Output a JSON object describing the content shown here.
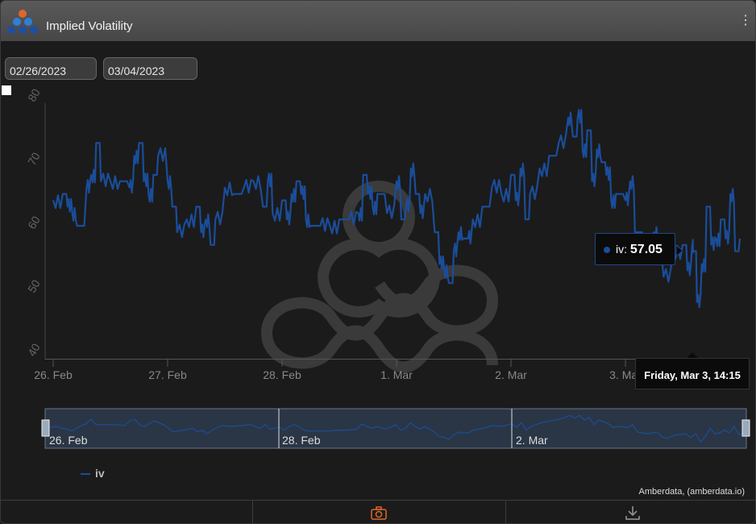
{
  "window": {
    "title": "Implied Volatility",
    "menu_glyph": "⋮"
  },
  "date_range": {
    "from": "02/26/2023",
    "to": "03/04/2023"
  },
  "chart_data": {
    "type": "line",
    "ylim": [
      40,
      80
    ],
    "yticks": [
      40,
      50,
      60,
      70,
      80
    ],
    "x_start": "2023-02-26T00:00",
    "x_end": "2023-03-04T00:00",
    "xtick_labels": [
      "26. Feb",
      "27. Feb",
      "28. Feb",
      "1. Mar",
      "2. Mar",
      "3. Mar"
    ],
    "series": [
      {
        "name": "iv",
        "color": "#1a4d9a",
        "points": [
          [
            "02-26 00:00",
            65
          ],
          [
            "02-26 02:00",
            66
          ],
          [
            "02-26 03:00",
            64
          ],
          [
            "02-26 04:00",
            63
          ],
          [
            "02-26 05:00",
            61
          ],
          [
            "02-26 07:00",
            67
          ],
          [
            "02-26 08:00",
            69
          ],
          [
            "02-26 09:00",
            74
          ],
          [
            "02-26 10:00",
            68
          ],
          [
            "02-26 12:00",
            68
          ],
          [
            "02-26 14:00",
            68
          ],
          [
            "02-26 16:00",
            67
          ],
          [
            "02-26 17:00",
            72
          ],
          [
            "02-26 18:00",
            74
          ],
          [
            "02-26 19:00",
            68
          ],
          [
            "02-26 20:00",
            66
          ],
          [
            "02-26 21:00",
            69
          ],
          [
            "02-26 22:00",
            72
          ],
          [
            "02-27 00:00",
            68
          ],
          [
            "02-27 01:00",
            64
          ],
          [
            "02-27 02:00",
            60
          ],
          [
            "02-27 04:00",
            62
          ],
          [
            "02-27 06:00",
            64
          ],
          [
            "02-27 07:00",
            60
          ],
          [
            "02-27 08:00",
            62
          ],
          [
            "02-27 09:00",
            58
          ],
          [
            "02-27 10:00",
            62
          ],
          [
            "02-27 12:00",
            67
          ],
          [
            "02-27 14:00",
            66
          ],
          [
            "02-27 16:00",
            67
          ],
          [
            "02-27 18:00",
            68
          ],
          [
            "02-27 20:00",
            64
          ],
          [
            "02-27 21:00",
            68
          ],
          [
            "02-27 22:00",
            63
          ],
          [
            "02-28 00:00",
            65
          ],
          [
            "02-28 01:00",
            62
          ],
          [
            "02-28 02:00",
            66
          ],
          [
            "02-28 03:00",
            68
          ],
          [
            "02-28 04:00",
            66
          ],
          [
            "02-28 05:00",
            62
          ],
          [
            "02-28 06:00",
            61
          ],
          [
            "02-28 08:00",
            61
          ],
          [
            "02-28 10:00",
            61
          ],
          [
            "02-28 12:00",
            62
          ],
          [
            "02-28 14:00",
            62
          ],
          [
            "02-28 16:00",
            63
          ],
          [
            "02-28 17:00",
            69
          ],
          [
            "02-28 18:00",
            66
          ],
          [
            "02-28 19:00",
            64
          ],
          [
            "02-28 20:00",
            66
          ],
          [
            "02-28 22:00",
            63
          ],
          [
            "03-01 00:00",
            68
          ],
          [
            "03-01 01:00",
            62
          ],
          [
            "03-01 02:00",
            64
          ],
          [
            "03-01 03:00",
            70
          ],
          [
            "03-01 04:00",
            66
          ],
          [
            "03-01 05:00",
            63
          ],
          [
            "03-01 06:00",
            66
          ],
          [
            "03-01 08:00",
            60
          ],
          [
            "03-01 09:00",
            55
          ],
          [
            "03-01 10:00",
            54
          ],
          [
            "03-01 11:00",
            52
          ],
          [
            "03-01 12:00",
            57
          ],
          [
            "03-01 13:00",
            60
          ],
          [
            "03-01 14:00",
            59
          ],
          [
            "03-01 15:00",
            59
          ],
          [
            "03-01 16:00",
            62
          ],
          [
            "03-01 18:00",
            64
          ],
          [
            "03-01 20:00",
            67
          ],
          [
            "03-01 22:00",
            66
          ],
          [
            "03-02 00:00",
            69
          ],
          [
            "03-02 01:00",
            65
          ],
          [
            "03-02 02:00",
            70
          ],
          [
            "03-02 03:00",
            62
          ],
          [
            "03-02 04:00",
            66
          ],
          [
            "03-02 06:00",
            70
          ],
          [
            "03-02 08:00",
            72
          ],
          [
            "03-02 10:00",
            74
          ],
          [
            "03-02 12:00",
            78
          ],
          [
            "03-02 13:00",
            75
          ],
          [
            "03-02 14:00",
            78
          ],
          [
            "03-02 15:00",
            73
          ],
          [
            "03-02 16:00",
            76
          ],
          [
            "03-02 17:00",
            68
          ],
          [
            "03-02 18:00",
            73
          ],
          [
            "03-02 19:00",
            71
          ],
          [
            "03-02 20:00",
            69
          ],
          [
            "03-02 21:00",
            65
          ],
          [
            "03-02 22:00",
            66
          ],
          [
            "03-03 00:00",
            65
          ],
          [
            "03-03 01:00",
            68
          ],
          [
            "03-03 02:00",
            60
          ],
          [
            "03-03 04:00",
            58
          ],
          [
            "03-03 06:00",
            60
          ],
          [
            "03-03 07:00",
            55
          ],
          [
            "03-03 08:00",
            53
          ],
          [
            "03-03 10:00",
            57
          ],
          [
            "03-03 12:00",
            58
          ],
          [
            "03-03 13:00",
            54
          ],
          [
            "03-03 14:00",
            58
          ],
          [
            "03-03 14:15",
            57.05
          ],
          [
            "03-03 15:00",
            49
          ],
          [
            "03-03 16:00",
            55
          ],
          [
            "03-03 17:00",
            64
          ],
          [
            "03-03 18:00",
            58
          ],
          [
            "03-03 19:00",
            59
          ],
          [
            "03-03 20:00",
            62
          ],
          [
            "03-03 21:00",
            59
          ],
          [
            "03-03 22:00",
            66
          ],
          [
            "03-03 23:00",
            57
          ],
          [
            "03-04 00:00",
            59
          ]
        ]
      }
    ],
    "tooltip": {
      "series": "iv",
      "value_label": "57.05",
      "time_label": "Friday, Mar 3, 14:15"
    },
    "navigator": {
      "labels": [
        "26. Feb",
        "28. Feb",
        "2. Mar"
      ]
    },
    "legend": [
      {
        "name": "iv",
        "color": "#1a4d9a"
      }
    ],
    "credits": "Amberdata, (amberdata.io)"
  },
  "toolbar": {
    "screenshot_icon": "camera-icon",
    "download_icon": "download-icon",
    "accent": "#e0662a"
  }
}
